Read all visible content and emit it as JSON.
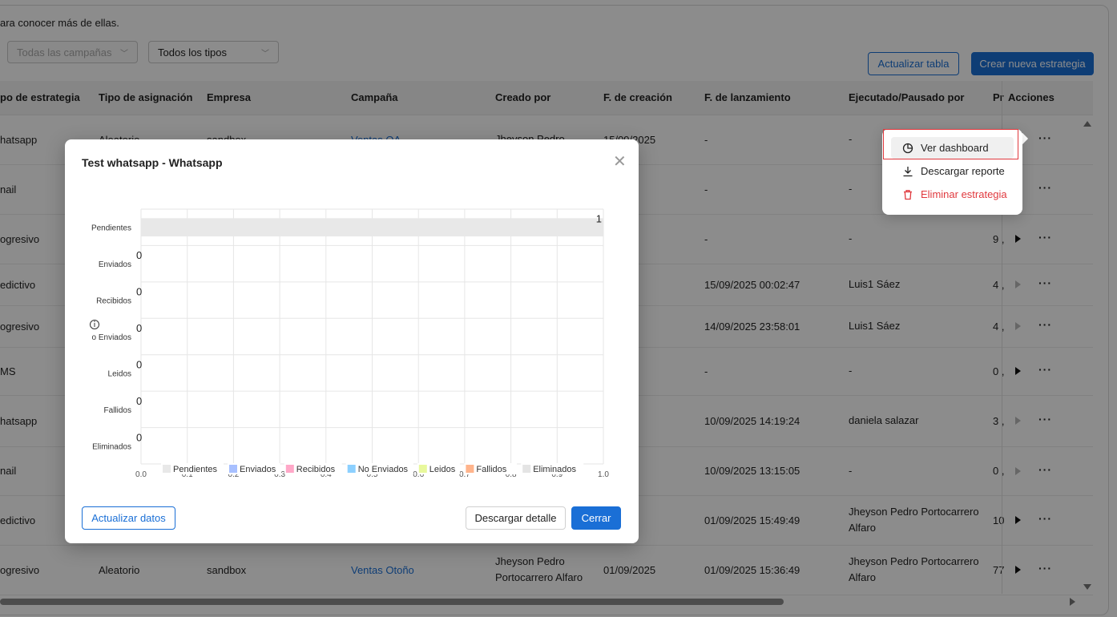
{
  "intro_text": "ara conocer más de ellas.",
  "filters": {
    "campaigns_placeholder": "Todas las campañas",
    "types_value": "Todos los tipos"
  },
  "toolbar": {
    "refresh_label": "Actualizar tabla",
    "new_strategy_label": "Crear nueva estrategia"
  },
  "table": {
    "headers": [
      "po de estrategia",
      "Tipo de asignación",
      "Empresa",
      "Campaña",
      "Creado por",
      "F. de creación",
      "F. de lanzamiento",
      "Ejecutado/Pausado por",
      "Pr",
      "Acciones"
    ],
    "rows": [
      {
        "type": "hatsapp",
        "assign": "Aleatorio",
        "company": "sandbox",
        "campaign": "Ventas QA",
        "created_by": "Jheyson Pedro",
        "created": "15/09/2025",
        "launch": "-",
        "by": "-",
        "pr": "",
        "play": "none"
      },
      {
        "type": "nail",
        "assign": "",
        "company": "",
        "campaign": "",
        "created_by": "",
        "created": "025",
        "launch": "-",
        "by": "-",
        "pr": "",
        "play": "none"
      },
      {
        "type": "ogresivo",
        "assign": "",
        "company": "",
        "campaign": "",
        "created_by": "",
        "created": "025",
        "launch": "-",
        "by": "-",
        "pr": "9 ,",
        "play": "active"
      },
      {
        "type": "edictivo",
        "assign": "",
        "company": "",
        "campaign": "",
        "created_by": "",
        "created": "025",
        "launch": "15/09/2025 00:02:47",
        "by": "Luis1 Sáez",
        "pr": "4 ,",
        "play": "disabled"
      },
      {
        "type": "ogresivo",
        "assign": "",
        "company": "",
        "campaign": "",
        "created_by": "",
        "created": "025",
        "launch": "14/09/2025 23:58:01",
        "by": "Luis1 Sáez",
        "pr": "4 ,",
        "play": "disabled"
      },
      {
        "type": "MS",
        "assign": "",
        "company": "",
        "campaign": "",
        "created_by": "",
        "created": "025",
        "launch": "-",
        "by": "-",
        "pr": "0 ,",
        "play": "active"
      },
      {
        "type": "hatsapp",
        "assign": "",
        "company": "",
        "campaign": "",
        "created_by": "",
        "created": "025",
        "launch": "10/09/2025 14:19:24",
        "by": "daniela salazar",
        "pr": "3 ,",
        "play": "disabled"
      },
      {
        "type": "nail",
        "assign": "",
        "company": "",
        "campaign": "",
        "created_by": "",
        "created": "025",
        "launch": "10/09/2025 13:15:05",
        "by": "-",
        "pr": "0 ,",
        "play": "disabled"
      },
      {
        "type": "edictivo",
        "assign": "",
        "company": "",
        "campaign": "",
        "created_by": "",
        "created": "025",
        "launch": "01/09/2025 15:49:49",
        "by": "Jheyson Pedro Portocarrero Alfaro",
        "pr": "10",
        "play": "active"
      },
      {
        "type": "ogresivo",
        "assign": "Aleatorio",
        "company": "sandbox",
        "campaign": "Ventas Otoño",
        "created_by": "Jheyson Pedro Portocarrero Alfaro",
        "created": "01/09/2025",
        "launch": "01/09/2025 15:36:49",
        "by": "Jheyson Pedro Portocarrero Alfaro",
        "pr": "77",
        "play": "active"
      }
    ],
    "more_label": "···"
  },
  "menu": {
    "items": [
      {
        "label": "Ver dashboard",
        "icon": "pie-chart-icon"
      },
      {
        "label": "Descargar reporte",
        "icon": "download-icon"
      },
      {
        "label": "Eliminar estrategia",
        "icon": "trash-icon"
      }
    ],
    "danger_color": "#e0393e"
  },
  "modal": {
    "title": "Test whatsapp - Whatsapp",
    "refresh_button": "Actualizar datos",
    "download_button": "Descargar detalle",
    "close_button": "Cerrar"
  },
  "chart_data": {
    "type": "bar",
    "orientation": "horizontal",
    "categories": [
      "Pendientes",
      "Enviados",
      "Recibidos",
      "No Enviados",
      "Leidos",
      "Fallidos",
      "Eliminados"
    ],
    "visible_category_labels": [
      "Pendientes",
      "Enviados",
      "Recibidos",
      "o Enviados",
      "Leidos",
      "Fallidos",
      "Eliminados"
    ],
    "values": [
      1,
      0,
      0,
      0,
      0,
      0,
      0
    ],
    "value_labels": [
      "1",
      "0",
      "0",
      "0",
      "0",
      "0",
      "0"
    ],
    "xlim": [
      0,
      1
    ],
    "x_ticks": [
      0.0,
      0.1,
      0.2,
      0.3,
      0.4,
      0.5,
      0.6,
      0.7,
      0.8,
      0.9,
      1.0
    ],
    "colors": [
      "#e8e8e8",
      "#a8c0ff",
      "#ffa8c8",
      "#8cd0ff",
      "#e8f89c",
      "#ffb48c",
      "#e4e4e4"
    ],
    "legend": [
      "Pendientes",
      "Enviados",
      "Recibidos",
      "No Enviados",
      "Leidos",
      "Fallidos",
      "Eliminados"
    ],
    "legend_position": "bottom",
    "grid": true
  },
  "colors": {
    "accent": "#1a6fd6",
    "overlay": "rgba(0,0,0,0.45)"
  }
}
